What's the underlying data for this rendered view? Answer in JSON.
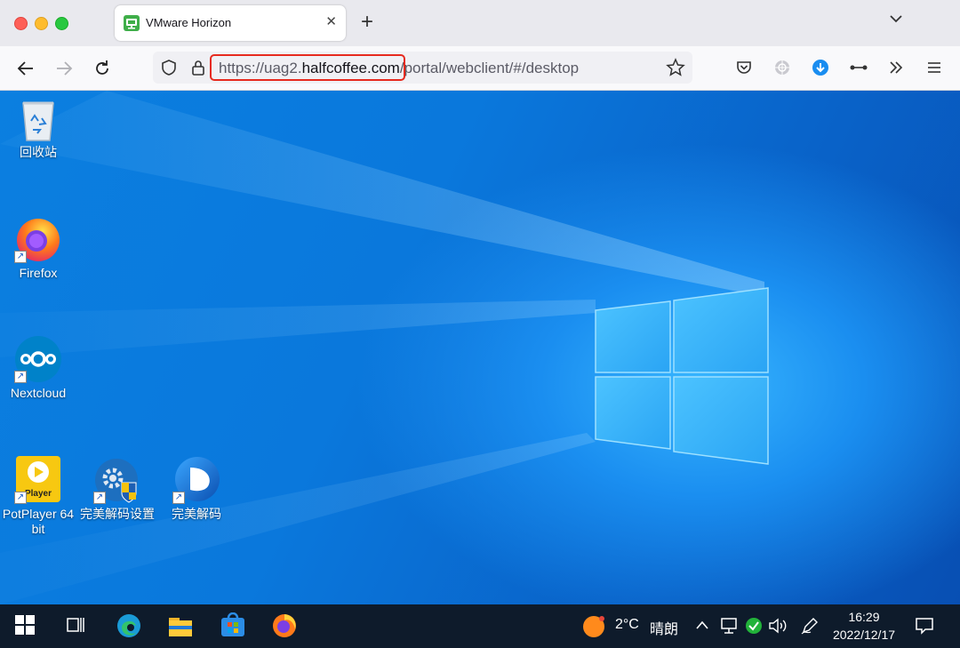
{
  "browser": {
    "tab": {
      "title": "VMware Horizon",
      "favicon": "vmware-horizon-icon",
      "close_glyph": "✕"
    },
    "new_tab_glyph": "+",
    "url": {
      "prefix": "https://uag2.",
      "domain": "halfcoffee.com",
      "path": "/portal/webclient/#/desktop"
    },
    "highlight_color": "#e62a1e",
    "toolbar_icons": [
      "back-icon",
      "forward-icon",
      "reload-icon",
      "shield-icon",
      "lock-icon",
      "bookmark-star-icon",
      "pocket-icon",
      "extension-icon",
      "download-icon",
      "more-tools-icon",
      "overflow-icon",
      "menu-icon"
    ]
  },
  "desktop": {
    "icons": [
      {
        "label": "回收站",
        "icon": "recycle-bin-icon"
      },
      {
        "label": "Firefox",
        "icon": "firefox-icon"
      },
      {
        "label": "Nextcloud",
        "icon": "nextcloud-icon"
      },
      {
        "label": "PotPlayer 64 bit",
        "icon": "potplayer-icon",
        "badge": "Player"
      },
      {
        "label": "完美解码设置",
        "icon": "decoder-settings-icon"
      },
      {
        "label": "完美解码",
        "icon": "decoder-icon"
      }
    ]
  },
  "taskbar": {
    "apps": [
      "start-icon",
      "task-view-icon",
      "edge-icon",
      "file-explorer-icon",
      "store-icon",
      "firefox-icon"
    ],
    "weather": {
      "temp": "2°C",
      "condition": "晴朗"
    },
    "time": "16:29",
    "date": "2022/12/17"
  }
}
